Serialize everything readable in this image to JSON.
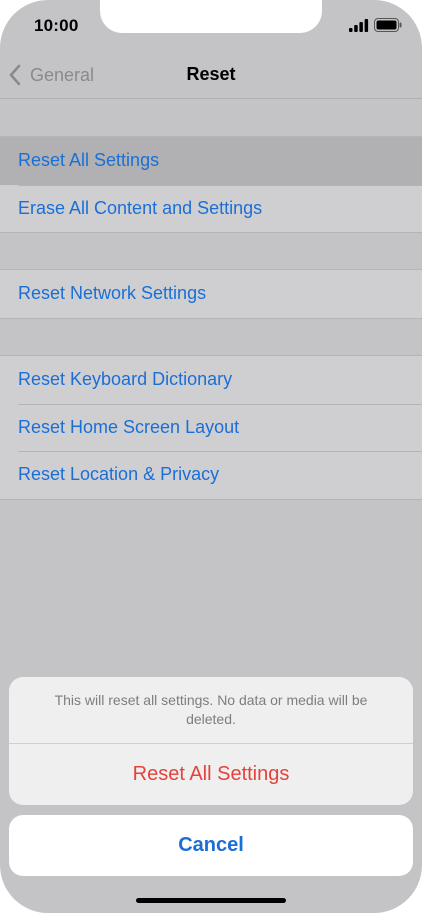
{
  "status_bar": {
    "time": "10:00"
  },
  "nav": {
    "back_label": "General",
    "title": "Reset"
  },
  "groups": [
    {
      "items": [
        {
          "label": "Reset All Settings"
        },
        {
          "label": "Erase All Content and Settings"
        }
      ]
    },
    {
      "items": [
        {
          "label": "Reset Network Settings"
        }
      ]
    },
    {
      "items": [
        {
          "label": "Reset Keyboard Dictionary"
        },
        {
          "label": "Reset Home Screen Layout"
        },
        {
          "label": "Reset Location & Privacy"
        }
      ]
    }
  ],
  "action_sheet": {
    "message": "This will reset all settings. No data or media will be deleted.",
    "action_label": "Reset All Settings",
    "cancel_label": "Cancel"
  },
  "colors": {
    "accent": "#1a6fd6",
    "destructive": "#e4433b"
  }
}
